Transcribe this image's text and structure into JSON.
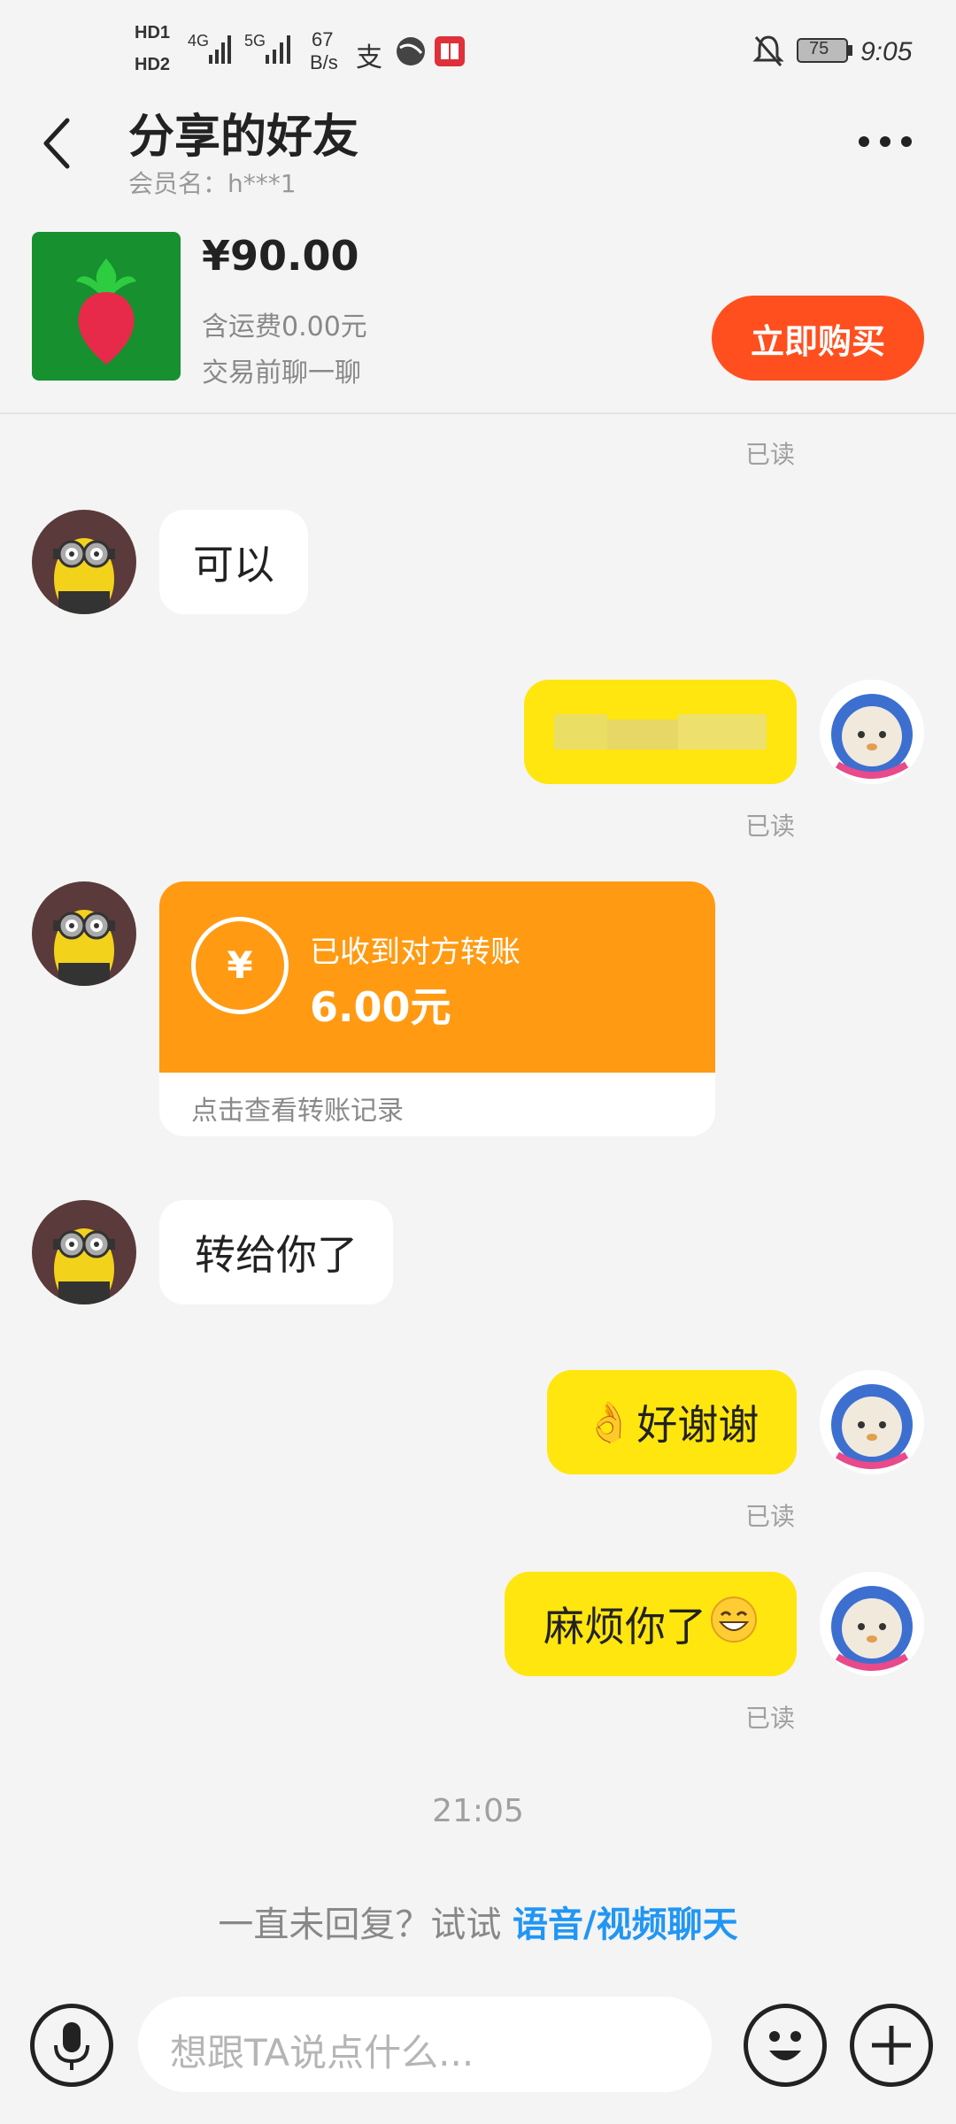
{
  "status_bar": {
    "sim1": "HD1",
    "sim2": "HD2",
    "net1": "4G",
    "net2": "5G",
    "speed_value": "67",
    "speed_unit": "B/s",
    "battery": "75",
    "time": "9:05"
  },
  "header": {
    "title": "分享的好友",
    "subtitle": "会员名：h***1"
  },
  "product": {
    "price": "¥90.00",
    "shipping": "含运费0.00元",
    "tip": "交易前聊一聊",
    "buy_label": "立即购买"
  },
  "messages": {
    "read_label": "已读",
    "msg_keyi": "可以",
    "msg_zhuangeini": "转给你了",
    "msg_haoxiexie": "好谢谢",
    "msg_mafan": "麻烦你了"
  },
  "transfer": {
    "title": "已收到对方转账",
    "amount": "6.00元",
    "footer": "点击查看转账记录"
  },
  "timestamp": "21:05",
  "hint": {
    "prefix": "一直未回复？试试 ",
    "link": "语音/视频聊天"
  },
  "input": {
    "placeholder": "想跟TA说点什么..."
  },
  "icons": [
    "back-icon",
    "more-icon",
    "mic-icon",
    "emoji-icon",
    "plus-icon",
    "mute-icon",
    "alipay-icon"
  ]
}
